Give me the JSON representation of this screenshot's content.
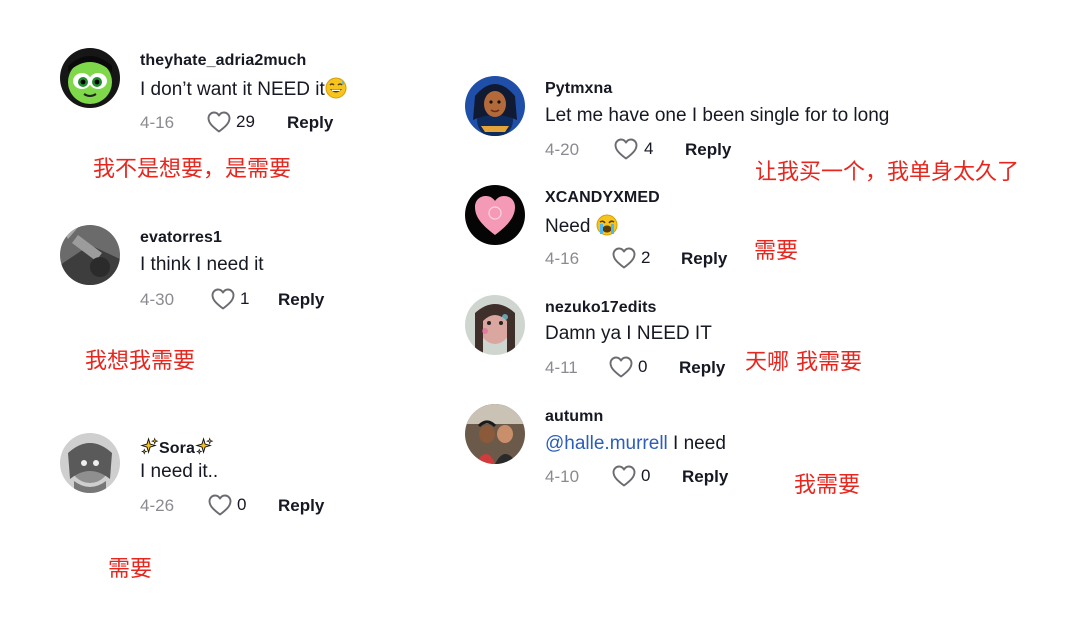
{
  "left": [
    {
      "username": "theyhate_adria2much",
      "text": "I don’t want it NEED it",
      "text_emoji": "sweat-smile-emoji",
      "date": "4-16",
      "likes": "29",
      "reply": "Reply",
      "translation": "我不是想要，是需要"
    },
    {
      "username": "evatorres1",
      "text": "I think I need it",
      "date": "4-30",
      "likes": "1",
      "reply": "Reply",
      "translation": "我想我需要"
    },
    {
      "username": "Sora",
      "username_decor": "sparkles-emoji",
      "text": "I need it..",
      "date": "4-26",
      "likes": "0",
      "reply": "Reply",
      "translation": "需要"
    }
  ],
  "right": [
    {
      "username": "Pytmxna",
      "text": "Let me have one I been single for to long",
      "date": "4-20",
      "likes": "4",
      "reply": "Reply",
      "translation": "让我买一个，我单身太久了"
    },
    {
      "username": "XCANDYXMED",
      "text": "Need",
      "text_emoji": "loudly-crying-emoji",
      "date": "4-16",
      "likes": "2",
      "reply": "Reply",
      "translation": "需要"
    },
    {
      "username": "nezuko17edits",
      "text": "Damn ya I NEED IT",
      "date": "4-11",
      "likes": "0",
      "reply": "Reply",
      "translation": "天哪 我需要"
    },
    {
      "username": "autumn",
      "mention": "@halle.murrell",
      "text": " I need",
      "date": "4-10",
      "likes": "0",
      "reply": "Reply",
      "translation": "我需要"
    }
  ],
  "colors": {
    "text": "#161823",
    "muted": "#8a8b91",
    "mention": "#2b5db9",
    "translation": "#e8261e"
  },
  "icons": {
    "like": "heart-outline-icon"
  }
}
